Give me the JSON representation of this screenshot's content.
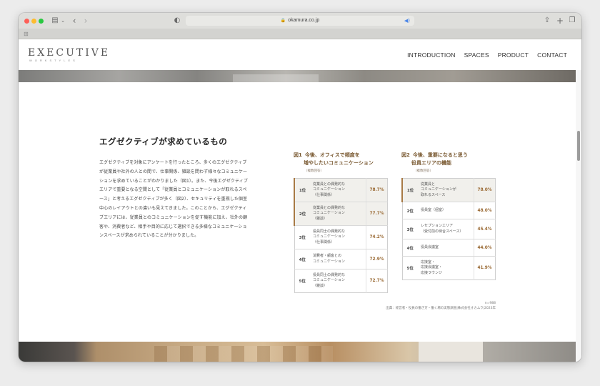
{
  "browser": {
    "url": "okamura.co.jp"
  },
  "site": {
    "logo_main": "EXECUTIVE",
    "logo_sub": "WORKSTYLES",
    "nav": [
      "INTRODUCTION",
      "SPACES",
      "PRODUCT",
      "CONTACT"
    ]
  },
  "section": {
    "title": "エグゼクティブが求めているもの",
    "body": "エグゼクティブを対象にアンケートを行ったところ、多くのエグゼクティブが従業員や社外の人との間で、仕事関係、雑談を問わず様々なコミュニケーションを求めていることがわかりました（図1）。また、今後エグゼクティブエリアで重要となる空間として「従業員とコミュニケーションが取れるスペース」と考えるエグゼクティブが多く（図2）、セキュリティを重視した個室中心のレイアウトとの違いも見えてきました。このことから、エグゼクティブエリアには、従業員とのコミュニケーションを促す機能に加え、社外の顧客や、消費者など、相手や目的に応じて選択できる多様なコミュニケーションスペースが求められていることが分かりました。"
  },
  "fig1": {
    "num": "図1",
    "title_line1": "今後、オフィスで頻度を",
    "title_line2": "増やしたいコミュニケーション",
    "sub": "（複数回答）",
    "rows": [
      {
        "rank": "1位",
        "lines": [
          "従業員との偶発的な",
          "コミュニケーション",
          "（仕事関係）"
        ],
        "pct": "78.7%",
        "hl": true
      },
      {
        "rank": "2位",
        "lines": [
          "従業員との偶発的な",
          "コミュニケーション",
          "（雑談）"
        ],
        "pct": "77.7%",
        "hl": true
      },
      {
        "rank": "3位",
        "lines": [
          "役員同士の偶発的な",
          "コミュニケーション",
          "（仕事関係）"
        ],
        "pct": "74.2%",
        "hl": false
      },
      {
        "rank": "4位",
        "lines": [
          "消費者・顧客との",
          "コミュニケーション"
        ],
        "pct": "72.9%",
        "hl": false
      },
      {
        "rank": "5位",
        "lines": [
          "役員同士の偶発的な",
          "コミュニケーション",
          "（雑談）"
        ],
        "pct": "72.7%",
        "hl": false
      }
    ]
  },
  "fig2": {
    "num": "図2",
    "title_line1": "今後、重要になると思う",
    "title_line2": "役員エリアの機能",
    "sub": "（複数回答）",
    "rows": [
      {
        "rank": "1位",
        "lines": [
          "従業員と",
          "コミュニケーションが",
          "取れるスペース"
        ],
        "pct": "78.0%",
        "hl": true
      },
      {
        "rank": "2位",
        "lines": [
          "役員室（個室）"
        ],
        "pct": "48.0%",
        "hl": false
      },
      {
        "rank": "3位",
        "lines": [
          "レセプションエリア",
          "（受付前の待合スペース）"
        ],
        "pct": "45.4%",
        "hl": false
      },
      {
        "rank": "4位",
        "lines": [
          "役員会議室"
        ],
        "pct": "44.0%",
        "hl": false
      },
      {
        "rank": "5位",
        "lines": [
          "応接室・",
          "応接会議室・",
          "応接ラウンジ"
        ],
        "pct": "41.9%",
        "hl": false
      }
    ]
  },
  "note": {
    "n": "n=988",
    "source": "出典：経営者・役員の働き方・働く場の実態調査|株式会社オカムラ|2023年"
  }
}
